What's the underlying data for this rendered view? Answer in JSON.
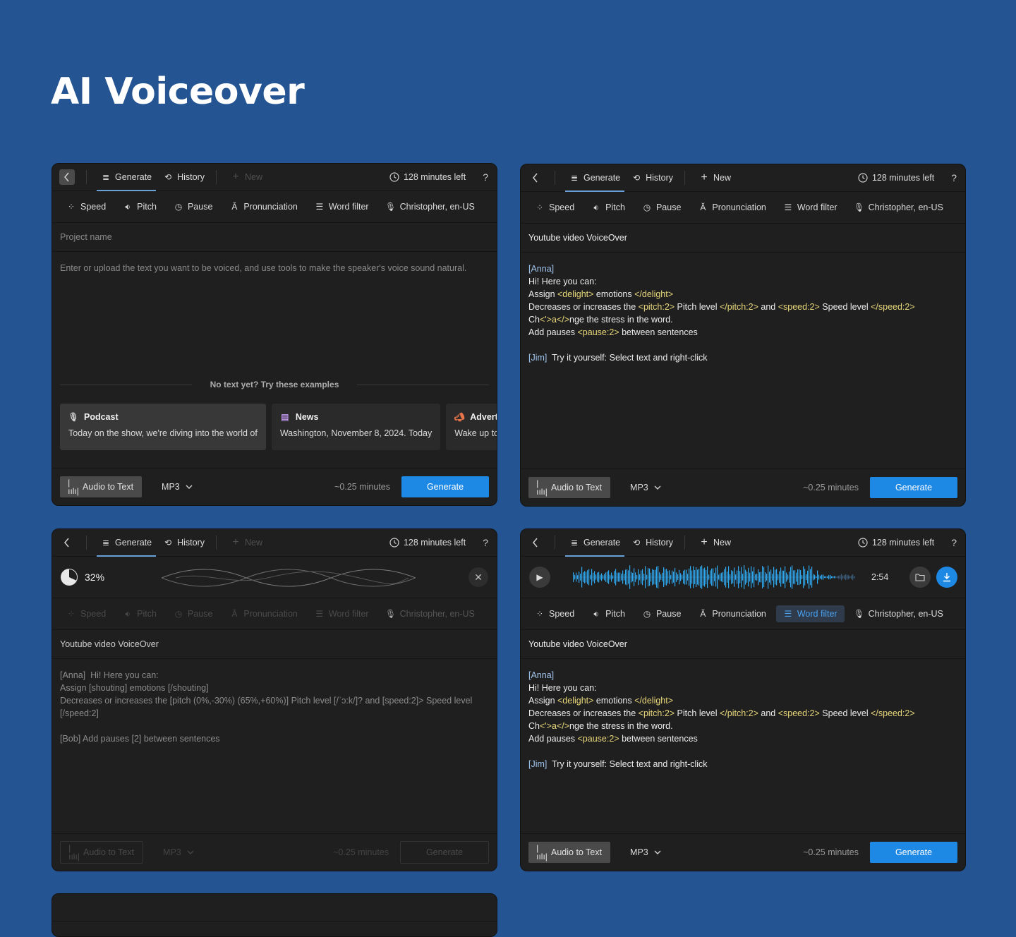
{
  "page": {
    "title": "AI Voiceover"
  },
  "header": {
    "generate": "Generate",
    "history": "History",
    "new": "New",
    "minutes_left": "128 minutes left",
    "help": "?"
  },
  "tools": {
    "speed": "Speed",
    "pitch": "Pitch",
    "pause": "Pause",
    "pronunciation": "Pronunciation",
    "word_filter": "Word filter",
    "voice": "Christopher, en-US"
  },
  "footer": {
    "audio_to_text": "Audio to Text",
    "format": "MP3",
    "estimate": "~0.25 minutes",
    "generate": "Generate"
  },
  "panel1": {
    "project_placeholder": "Project name",
    "text_placeholder": "Enter or upload the text you want to be voiced, and use tools to make the speaker's voice sound natural.",
    "examples_heading": "No text yet? Try these examples",
    "examples": [
      {
        "title": "Podcast",
        "desc": "Today on the show, we're diving into the world of",
        "icon": "microphone-icon"
      },
      {
        "title": "News",
        "desc": "Washington, November 8, 2024. Today",
        "icon": "news-icon"
      },
      {
        "title": "Advertisement",
        "desc": "Wake up to barista-quality coffee every",
        "icon": "megaphone-icon"
      }
    ]
  },
  "panel2": {
    "project_name": "Youtube video VoiceOver",
    "lines": {
      "l1": "[Anna]",
      "l2": "Hi! Here you can:",
      "l3a": "Assign ",
      "l3b": "<delight>",
      "l3c": " emotions ",
      "l3d": "</delight>",
      "l4a": "Decreases or increases the ",
      "l4b": "<pitch:2>",
      "l4c": " Pitch level ",
      "l4d": "</pitch:2>",
      "l4e": " and ",
      "l4f": "<speed:2>",
      "l4g": " Speed level ",
      "l4h": "</speed:2>",
      "l5a": "Ch",
      "l5b": "<'>a</>",
      "l5c": "nge the stress in the word.",
      "l6a": "Add pauses ",
      "l6b": "<pause:2>",
      "l6c": " between sentences",
      "l7a": "[Jim]",
      "l7b": "  Try it yourself: Select text and right-click"
    }
  },
  "panel3": {
    "progress": "32%",
    "progress_value": 0.32,
    "project_name": "Youtube video VoiceOver",
    "lines": {
      "l1": "[Anna]  Hi! Here you can:",
      "l2": "Assign [shouting] emotions [/shouting]",
      "l3": "Decreases or increases the [pitch (0%,-30%) (65%,+60%)] Pitch level [/ˈɔ:k/]? and [speed:2]> Speed level",
      "l4": "[/speed:2]",
      "l5": "[Bob] Add pauses [2] between sentences"
    }
  },
  "panel4": {
    "duration": "2:54"
  },
  "colors": {
    "background": "#245592",
    "panel": "#1f1f1f",
    "accent": "#1e88e5",
    "tag": "#e8d77a",
    "speaker": "#9fc4ee"
  }
}
